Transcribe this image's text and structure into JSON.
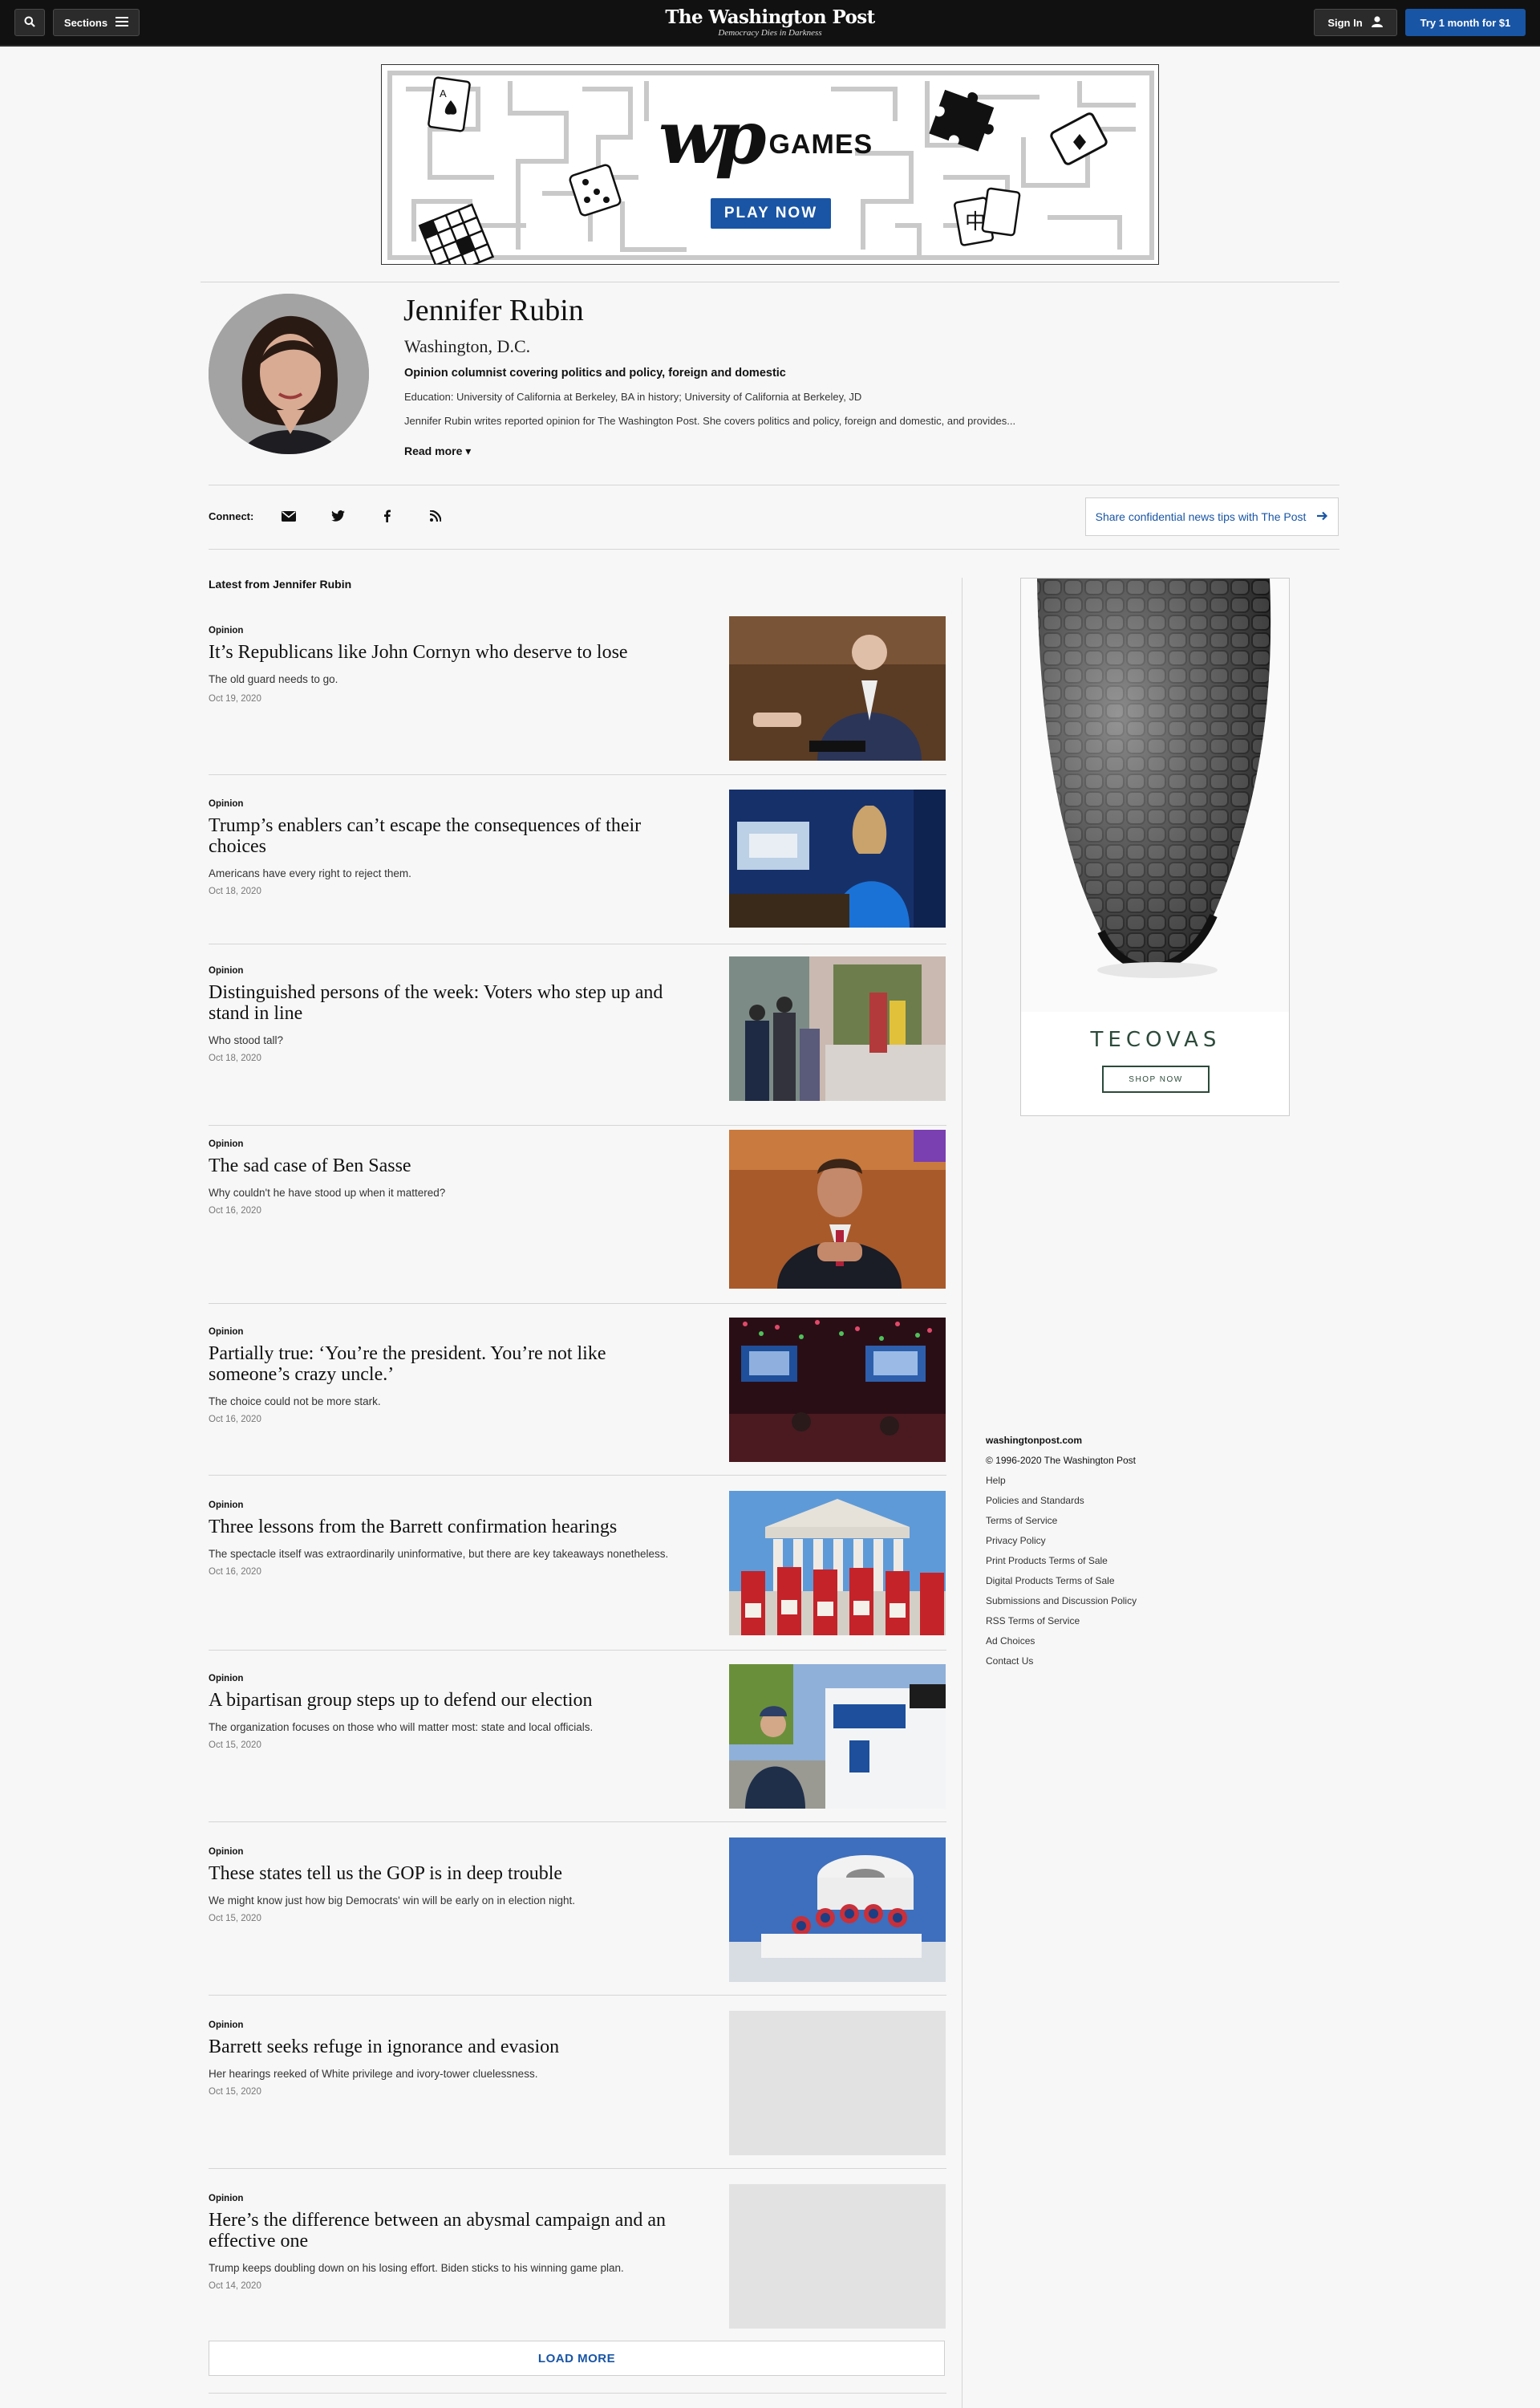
{
  "header": {
    "sections_label": "Sections",
    "masthead_title": "The Washington Post",
    "masthead_tagline": "Democracy Dies in Darkness",
    "sign_in_label": "Sign In",
    "trial_label": "Try 1 month for $1"
  },
  "games_ad": {
    "logo_mark": "wp",
    "logo_word": "GAMES",
    "play_label": "PLAY NOW"
  },
  "author": {
    "name": "Jennifer Rubin",
    "location": "Washington, D.C.",
    "role": "Opinion columnist covering politics and policy, foreign and domestic",
    "education": "Education: University of California at Berkeley, BA in history; University of California at Berkeley, JD",
    "bio": "Jennifer Rubin writes reported opinion for The Washington Post. She covers politics and policy, foreign and domestic, and provides...",
    "read_more": "Read more"
  },
  "connect": {
    "label": "Connect:",
    "icons": [
      "email-icon",
      "twitter-icon",
      "facebook-icon",
      "rss-icon"
    ],
    "tips_label": "Share confidential news tips with The Post"
  },
  "feed": {
    "title": "Latest from Jennifer Rubin",
    "stories": [
      {
        "kicker": "Opinion",
        "headline": "It’s Republicans like John Cornyn who deserve to lose",
        "blurb": "The old guard needs to go.",
        "date": "Oct 19, 2020"
      },
      {
        "kicker": "Opinion",
        "headline": "Trump’s enablers can’t escape the consequences of their choices",
        "blurb": "Americans have every right to reject them.",
        "date": "Oct 18, 2020"
      },
      {
        "kicker": "Opinion",
        "headline": "Distinguished persons of the week: Voters who step up and stand in line",
        "blurb": "Who stood tall?",
        "date": "Oct 18, 2020"
      },
      {
        "kicker": "Opinion",
        "headline": "The sad case of Ben Sasse",
        "blurb": "Why couldn't he have stood up when it mattered?",
        "date": "Oct 16, 2020"
      },
      {
        "kicker": "Opinion",
        "headline": "Partially true: ‘You’re the president. You’re not like someone’s crazy uncle.’",
        "blurb": "The choice could not be more stark.",
        "date": "Oct 16, 2020"
      },
      {
        "kicker": "Opinion",
        "headline": "Three lessons from the Barrett confirmation hearings",
        "blurb": "The spectacle itself was extraordinarily uninformative, but there are key takeaways nonetheless.",
        "date": "Oct 16, 2020"
      },
      {
        "kicker": "Opinion",
        "headline": "A bipartisan group steps up to defend our election",
        "blurb": "The organization focuses on those who will matter most: state and local officials.",
        "date": "Oct 15, 2020"
      },
      {
        "kicker": "Opinion",
        "headline": "These states tell us the GOP is in deep trouble",
        "blurb": "We might know just how big Democrats' win will be early on in election night.",
        "date": "Oct 15, 2020"
      },
      {
        "kicker": "Opinion",
        "headline": "Barrett seeks refuge in ignorance and evasion",
        "blurb": "Her hearings reeked of White privilege and ivory-tower cluelessness.",
        "date": "Oct 15, 2020"
      },
      {
        "kicker": "Opinion",
        "headline": "Here’s the difference between an abysmal campaign and an effective one",
        "blurb": "Trump keeps doubling down on his losing effort. Biden sticks to his winning game plan.",
        "date": "Oct 14, 2020"
      }
    ],
    "load_more": "LOAD MORE"
  },
  "side_ad": {
    "brand": "TECOVAS",
    "cta": "SHOP NOW"
  },
  "footer": {
    "site": "washingtonpost.com",
    "copyright": "© 1996-2020 The Washington Post",
    "links": [
      "Help",
      "Policies and Standards",
      "Terms of Service",
      "Privacy Policy",
      "Print Products Terms of Sale",
      "Digital Products Terms of Sale",
      "Submissions and Discussion Policy",
      "RSS Terms of Service",
      "Ad Choices",
      "Contact Us"
    ]
  },
  "colors": {
    "topbar": "#111111",
    "accent_blue": "#1955a5",
    "page_bg": "#f7f7f7",
    "ad_green": "#2c4a3a"
  }
}
